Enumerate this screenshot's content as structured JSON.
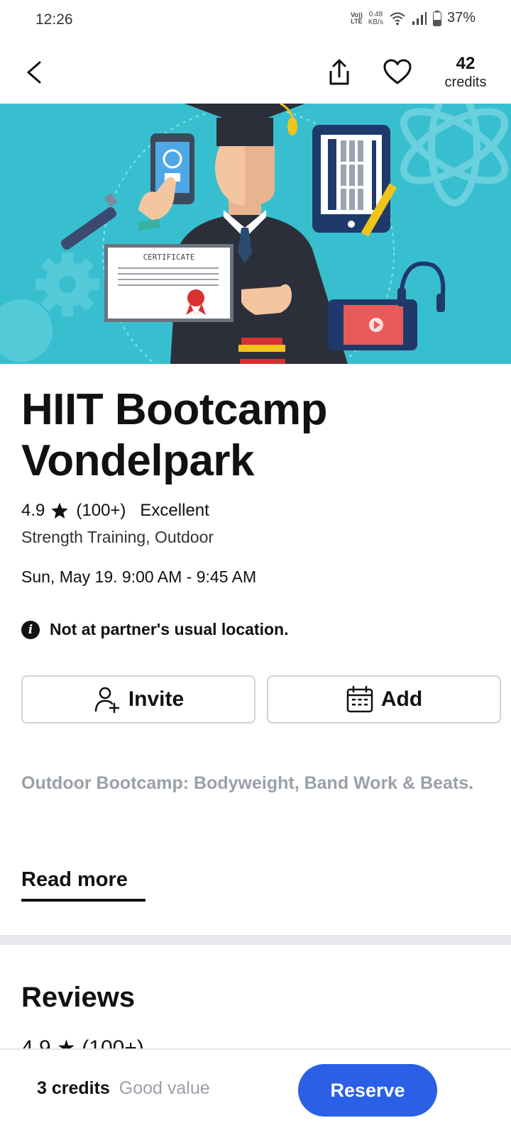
{
  "status_bar": {
    "time": "12:26",
    "volte": "VoLTE",
    "speed_value": "0.48",
    "speed_unit": "KB/s",
    "battery": "37%"
  },
  "app_bar": {
    "credits_value": "42",
    "credits_label": "credits"
  },
  "hero": {
    "certificate_text": "CERTIFICATE"
  },
  "class": {
    "title": "HIIT Bootcamp Vondelpark",
    "rating": "4.9",
    "rating_count": "(100+)",
    "rating_label": "Excellent",
    "categories": "Strength Training, Outdoor",
    "datetime": "Sun, May 19.  9:00 AM - 9:45 AM",
    "notice": "Not at partner's usual location.",
    "description": "Outdoor Bootcamp: Bodyweight, Band Work & Beats."
  },
  "actions": {
    "invite_label": "Invite",
    "add_label": "Add",
    "read_more_label": "Read more"
  },
  "reviews": {
    "title": "Reviews",
    "peek": "4.9 ★ (100+)"
  },
  "footer": {
    "price": "3 credits",
    "price_note": "Good value",
    "reserve_label": "Reserve"
  },
  "colors": {
    "accent": "#2a5fe6",
    "hero_bg": "#38bfcf",
    "muted_text": "#9aa0a8"
  }
}
